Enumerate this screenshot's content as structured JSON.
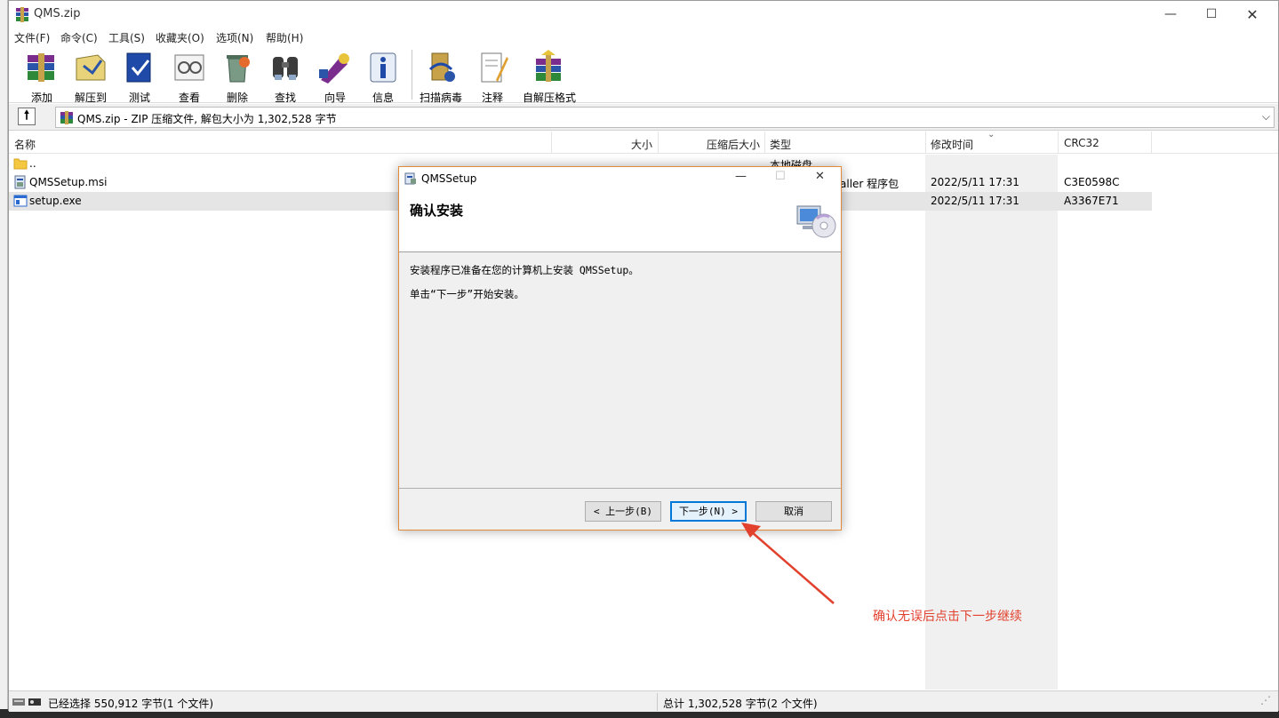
{
  "window": {
    "title": "QMS.zip",
    "controls": {
      "minimize": "—",
      "maximize": "☐",
      "close": "✕"
    }
  },
  "menu": [
    "文件(F)",
    "命令(C)",
    "工具(S)",
    "收藏夹(O)",
    "选项(N)",
    "帮助(H)"
  ],
  "toolbar": [
    {
      "label": "添加",
      "icon": "add-archive-icon"
    },
    {
      "label": "解压到",
      "icon": "extract-to-icon"
    },
    {
      "label": "测试",
      "icon": "test-icon"
    },
    {
      "label": "查看",
      "icon": "view-icon"
    },
    {
      "label": "删除",
      "icon": "delete-icon"
    },
    {
      "label": "查找",
      "icon": "find-icon"
    },
    {
      "label": "向导",
      "icon": "wizard-icon"
    },
    {
      "label": "信息",
      "icon": "info-icon"
    },
    {
      "label": "扫描病毒",
      "icon": "virus-scan-icon"
    },
    {
      "label": "注释",
      "icon": "comment-icon"
    },
    {
      "label": "自解压格式",
      "icon": "sfx-icon"
    }
  ],
  "address": {
    "text": "QMS.zip - ZIP 压缩文件, 解包大小为 1,302,528 字节"
  },
  "columns": {
    "name": "名称",
    "size": "大小",
    "packed": "压缩后大小",
    "type": "类型",
    "modified": "修改时间",
    "crc": "CRC32"
  },
  "files": [
    {
      "name": "..",
      "size": "",
      "packed": "",
      "type": "本地磁盘",
      "modified": "",
      "crc": "",
      "icon": "folder-icon"
    },
    {
      "name": "QMSSetup.msi",
      "size": "",
      "packed": "",
      "type": "aller 程序包",
      "modified": "2022/5/11 17:31",
      "crc": "C3E0598C",
      "icon": "msi-file-icon"
    },
    {
      "name": "setup.exe",
      "size": "",
      "packed": "",
      "type": "",
      "modified": "2022/5/11 17:31",
      "crc": "A3367E71",
      "icon": "exe-file-icon"
    }
  ],
  "status": {
    "left": "已经选择 550,912 字节(1 个文件)",
    "right": "总计 1,302,528 字节(2 个文件)"
  },
  "dialog": {
    "title": "QMSSetup",
    "heading": "确认安装",
    "line1": "安装程序已准备在您的计算机上安装 QMSSetup。",
    "line2": "单击“下一步”开始安装。",
    "back": "< 上一步(B)",
    "next": "下一步(N) >",
    "cancel": "取消",
    "controls": {
      "minimize": "—",
      "maximize": "☐",
      "close": "✕"
    }
  },
  "annotation": {
    "text": "确认无误后点击下一步继续",
    "color": "#e2412e"
  }
}
